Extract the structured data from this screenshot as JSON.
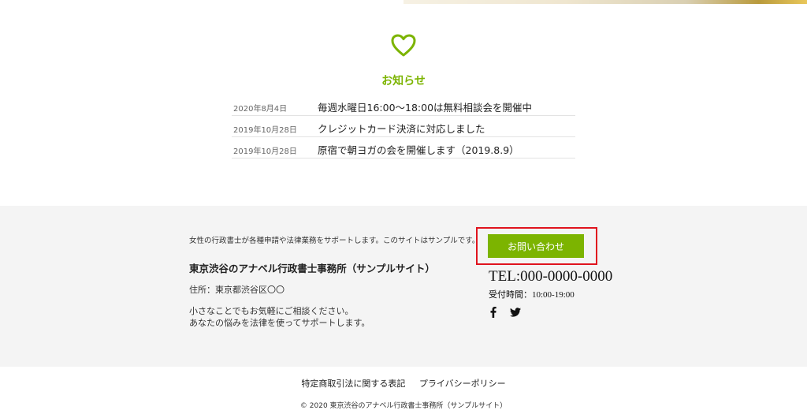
{
  "news": {
    "heart_icon": "heart-outline-icon",
    "title": "お知らせ",
    "items": [
      {
        "date": "2020年8月4日",
        "text": "毎週水曜日16:00〜18:00は無料相談会を開催中"
      },
      {
        "date": "2019年10月28日",
        "text": "クレジットカード決済に対応しました"
      },
      {
        "date": "2019年10月28日",
        "text": "原宿で朝ヨガの会を開催します（2019.8.9）"
      }
    ]
  },
  "footer": {
    "tagline": "女性の行政書士が各種申請や法律業務をサポートします。このサイトはサンプルです。",
    "office_name": "東京渋谷のアナベル行政書士事務所（サンプルサイト）",
    "address": "住所：東京都渋谷区〇〇",
    "message_line1": "小さなことでもお気軽にご相談ください。",
    "message_line2": "あなたの悩みを法律を使ってサポートします。",
    "contact_button": "お問い合わせ",
    "tel": "TEL:000-0000-0000",
    "hours": "受付時間：10:00-19:00",
    "social": [
      "facebook-icon",
      "twitter-icon"
    ]
  },
  "bottom": {
    "link_tokushoho": "特定商取引法に関する表記",
    "link_privacy": "プライバシーポリシー",
    "copyright": "© 2020 東京渋谷のアナベル行政書士事務所（サンプルサイト）"
  },
  "colors": {
    "accent": "#7cb400",
    "highlight": "#e0141e",
    "footer_bg": "#f4f4f4"
  }
}
